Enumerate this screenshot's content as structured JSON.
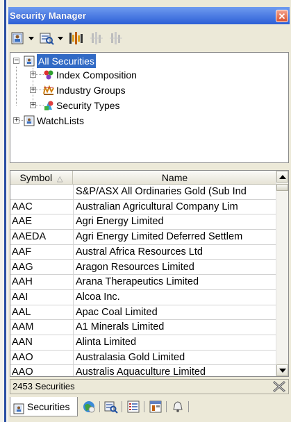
{
  "window": {
    "title": "Security Manager",
    "close_glyph": "✕"
  },
  "toolbar": {
    "icons": [
      "securities-icon",
      "browse-icon",
      "chart-icon",
      "chart-disabled-icon",
      "chart-disabled-icon"
    ]
  },
  "tree": {
    "root": "All Securities",
    "children": [
      "Index Composition",
      "Industry Groups",
      "Security Types"
    ],
    "sibling": "WatchLists",
    "expander_plus": "+",
    "expander_minus": "−"
  },
  "grid": {
    "columns": [
      {
        "label": "Symbol",
        "sort": "ascending"
      },
      {
        "label": "Name"
      }
    ],
    "sort_glyph": "△",
    "rows": [
      {
        "symbol": "",
        "name": "S&P/ASX All Ordinaries Gold (Sub Ind"
      },
      {
        "symbol": "AAC",
        "name": "Australian Agricultural Company Lim"
      },
      {
        "symbol": "AAE",
        "name": "Agri Energy Limited"
      },
      {
        "symbol": "AAEDA",
        "name": "Agri Energy Limited Deferred Settlem"
      },
      {
        "symbol": "AAF",
        "name": "Austral Africa Resources Ltd"
      },
      {
        "symbol": "AAG",
        "name": "Aragon Resources Limited"
      },
      {
        "symbol": "AAH",
        "name": "Arana Therapeutics Limited"
      },
      {
        "symbol": "AAI",
        "name": "Alcoa Inc."
      },
      {
        "symbol": "AAL",
        "name": "Apac Coal Limited"
      },
      {
        "symbol": "AAM",
        "name": "A1 Minerals Limited"
      },
      {
        "symbol": "AAN",
        "name": "Alinta Limited"
      },
      {
        "symbol": "AAO",
        "name": "Australasia Gold Limited"
      },
      {
        "symbol": "AAO",
        "name": "Australis Aquaculture Limited"
      }
    ]
  },
  "status": {
    "count_text": "2453 Securities"
  },
  "tabs": {
    "active_label": "Securities",
    "icons": [
      "securities-icon",
      "globe-icon",
      "browse-icon",
      "list-icon",
      "window-icon",
      "alert-bell-icon"
    ]
  },
  "colors": {
    "title_bar": "#2c5fd6",
    "selection": "#316ac5",
    "panel_bg": "#ece9d8"
  }
}
